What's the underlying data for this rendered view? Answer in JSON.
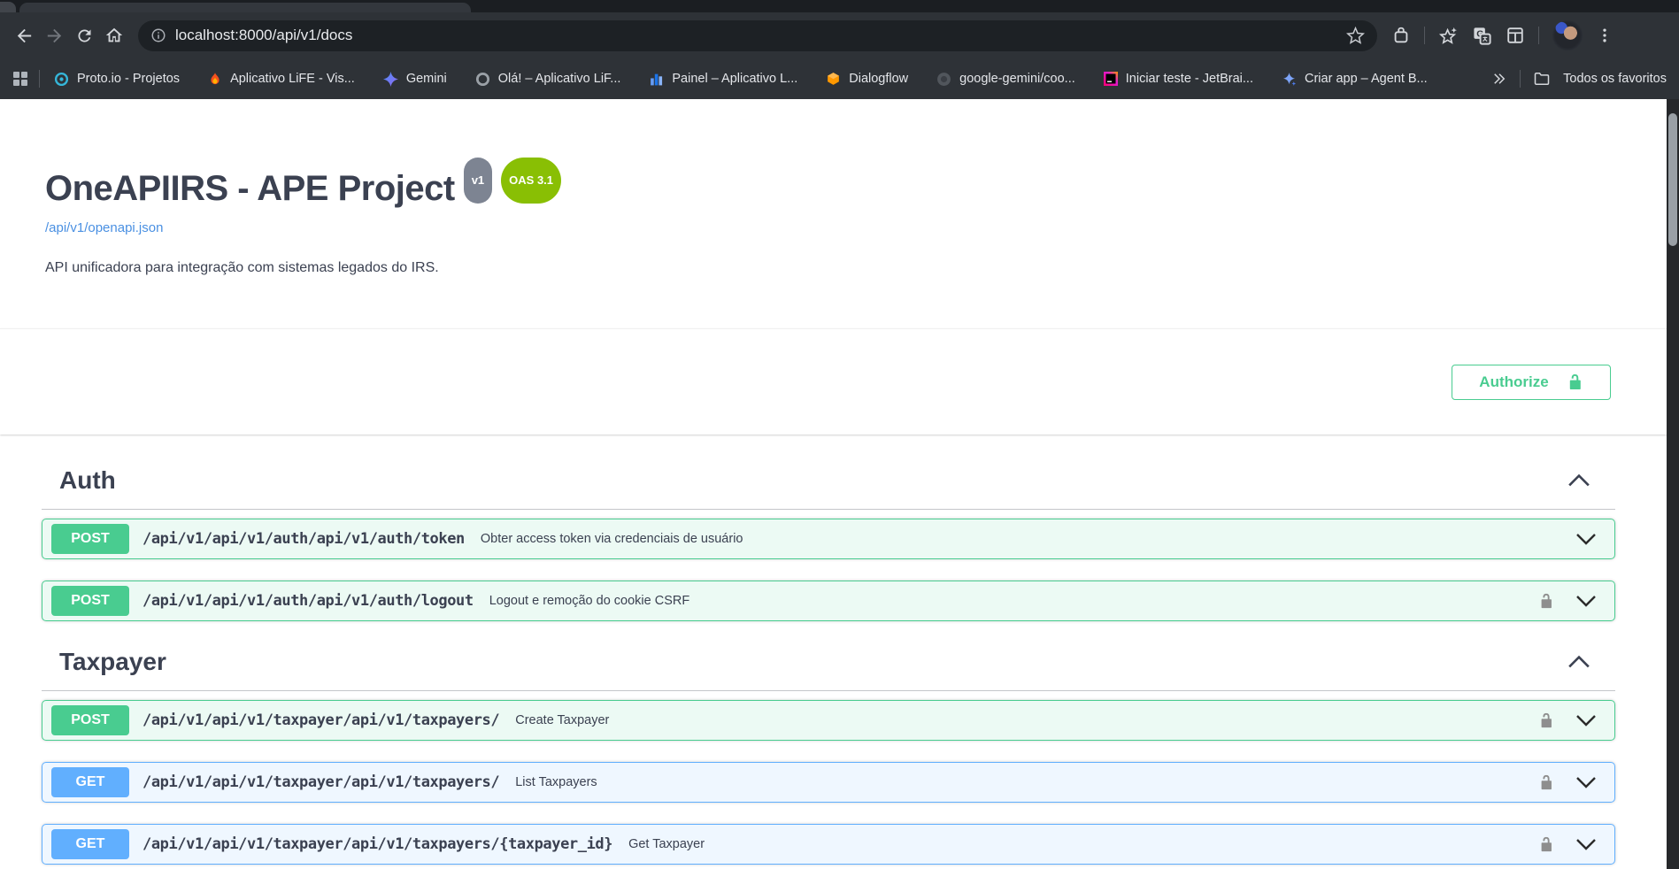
{
  "browser": {
    "url": "localhost:8000/api/v1/docs",
    "toolbar_icons": [
      "back-icon",
      "forward-icon",
      "reload-icon",
      "home-icon",
      "page-info-icon",
      "bookmark-star-icon",
      "extensions-icon",
      "bookmark-sparkle-icon",
      "translate-icon",
      "reading-list-icon",
      "profile-avatar",
      "menu-dots-icon"
    ],
    "bookmarks_bar": {
      "apps_icon": "apps-grid-icon",
      "items": [
        {
          "label": "Proto.io - Projetos",
          "icon": "proto-io"
        },
        {
          "label": "Aplicativo LiFE - Vis...",
          "icon": "flame"
        },
        {
          "label": "Gemini",
          "icon": "gemini-sparkle"
        },
        {
          "label": "Olá! – Aplicativo LiF...",
          "icon": "gray-ring"
        },
        {
          "label": "Painel – Aplicativo L...",
          "icon": "bar-chart"
        },
        {
          "label": "Dialogflow",
          "icon": "dialogflow-hexagon"
        },
        {
          "label": "google-gemini/coo...",
          "icon": "dark-circle"
        },
        {
          "label": "Iniciar teste - JetBrai...",
          "icon": "jetbrains"
        },
        {
          "label": "Criar app – Agent B...",
          "icon": "blue-sparkle"
        }
      ],
      "overflow_icon": "chevron-double-right-icon",
      "all_favorites_label": "Todos os favoritos",
      "all_favorites_icon": "folder-icon"
    }
  },
  "api": {
    "title": "OneAPIIRS - APE Project",
    "version_badge": "v1",
    "oas_badge": "OAS 3.1",
    "spec_link": "/api/v1/openapi.json",
    "description": "API unificadora para integração com sistemas legados do IRS.",
    "authorize_label": "Authorize"
  },
  "sections": [
    {
      "name": "Auth",
      "expanded": true,
      "operations": [
        {
          "method": "POST",
          "path": "/api/v1/api/v1/auth/api/v1/auth/token",
          "summary": "Obter access token via credenciais de usuário",
          "locked": false
        },
        {
          "method": "POST",
          "path": "/api/v1/api/v1/auth/api/v1/auth/logout",
          "summary": "Logout e remoção do cookie CSRF",
          "locked": true
        }
      ]
    },
    {
      "name": "Taxpayer",
      "expanded": true,
      "operations": [
        {
          "method": "POST",
          "path": "/api/v1/api/v1/taxpayer/api/v1/taxpayers/",
          "summary": "Create Taxpayer",
          "locked": true
        },
        {
          "method": "GET",
          "path": "/api/v1/api/v1/taxpayer/api/v1/taxpayers/",
          "summary": "List Taxpayers",
          "locked": true
        },
        {
          "method": "GET",
          "path": "/api/v1/api/v1/taxpayer/api/v1/taxpayers/{taxpayer_id}",
          "summary": "Get Taxpayer",
          "locked": true
        }
      ]
    }
  ],
  "colors": {
    "post": "#49cc90",
    "get": "#61affe",
    "oas_badge": "#89bf04",
    "version_badge": "#7d8492",
    "link": "#4a90e2",
    "text": "#3b4151",
    "toolbar_bg": "#2e3237",
    "omnibox_bg": "#1d2125"
  }
}
